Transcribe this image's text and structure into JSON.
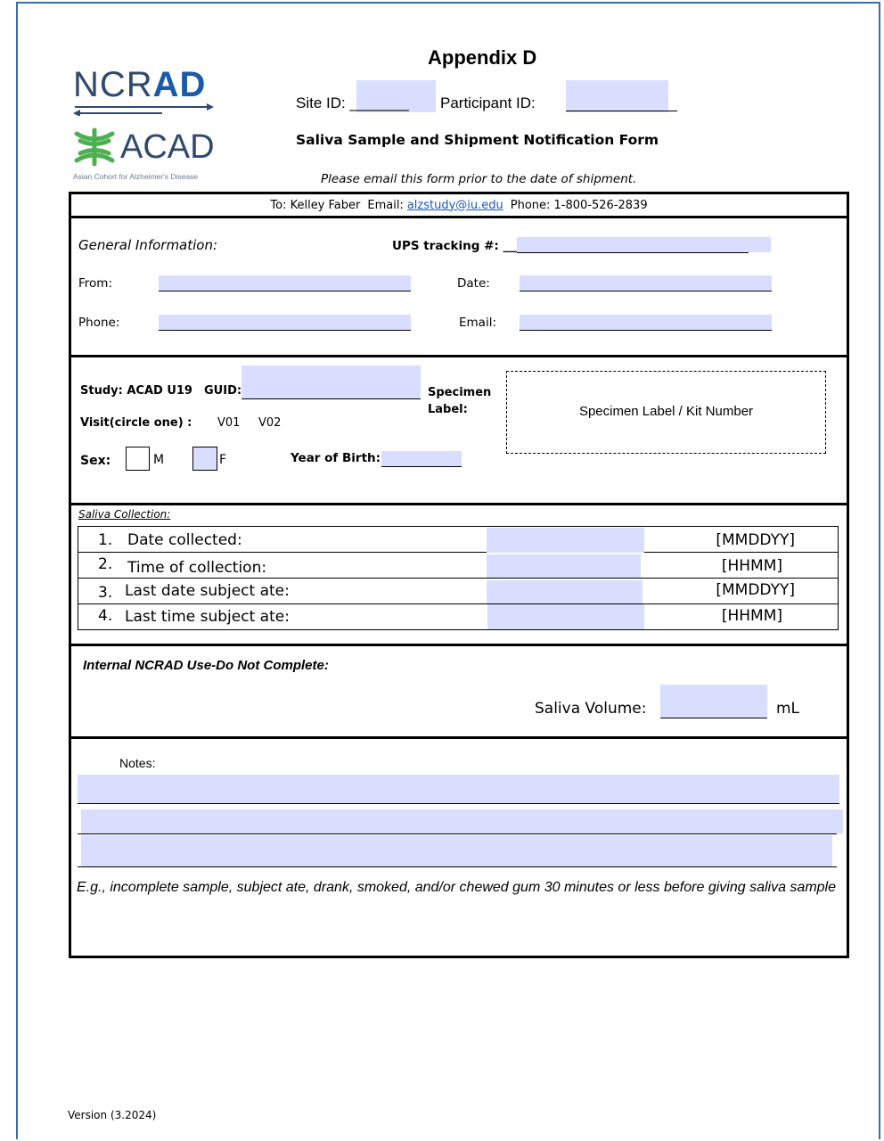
{
  "logos": {
    "ncrad_prefix": "NCR",
    "ncrad_bold": "AD",
    "acad": "ACAD",
    "acad_subtitle": "Asian Cohort for Alzheimer's Disease"
  },
  "header": {
    "title": "Appendix D",
    "site_id_label": "Site ID: _______",
    "participant_id_label": "Participant ID:",
    "form_title": "Saliva Sample and Shipment Notification Form",
    "email_note": "Please email this form prior to the date of shipment."
  },
  "contact": {
    "to": "To:  Kelley Faber",
    "email_label": "Email:",
    "email": "alzstudy@iu.edu",
    "phone": "Phone: 1-800-526-2839"
  },
  "general": {
    "heading": "General Information:",
    "ups_label": "UPS tracking #: ___",
    "from_label": "From:",
    "date_label": "Date:",
    "phone_label": "Phone:",
    "email_label": "Email:"
  },
  "study": {
    "study_label": "Study: ACAD U19",
    "guid_label": "GUID:",
    "specimen_label": "Specimen Label:",
    "specimen_box": "Specimen Label / Kit Number",
    "visit_label": "Visit(circle one) :",
    "visit_1": "V01",
    "visit_2": "V02",
    "sex_label": "Sex:",
    "sex_m": "M",
    "sex_f": "F",
    "yob_label": "Year of Birth:"
  },
  "saliva": {
    "heading": "Saliva Collection:",
    "rows": [
      {
        "num": "1.",
        "label": "Date collected:",
        "unit": "[MMDDYY]"
      },
      {
        "num": "2.",
        "label": "Time of collection:",
        "unit": "[HHMM]"
      },
      {
        "num": "3.",
        "label": "Last date subject ate:",
        "unit": "[MMDDYY]"
      },
      {
        "num": "4.",
        "label": "Last time subject ate:",
        "unit": "[HHMM]"
      }
    ]
  },
  "internal": {
    "heading": "Internal NCRAD Use-Do Not Complete:",
    "volume_label": "Saliva Volume:",
    "volume_unit": "mL"
  },
  "notes": {
    "label": "Notes:",
    "example": "E.g., incomplete sample, subject ate, drank, smoked, and/or chewed gum 30 minutes or less before giving saliva sample"
  },
  "footer": {
    "version": "Version (3.2024)"
  },
  "colors": {
    "field_fill": "#d9deff",
    "brand_blue": "#1a5aa8",
    "acad_green": "#4caf50",
    "link": "#1a56c4"
  }
}
